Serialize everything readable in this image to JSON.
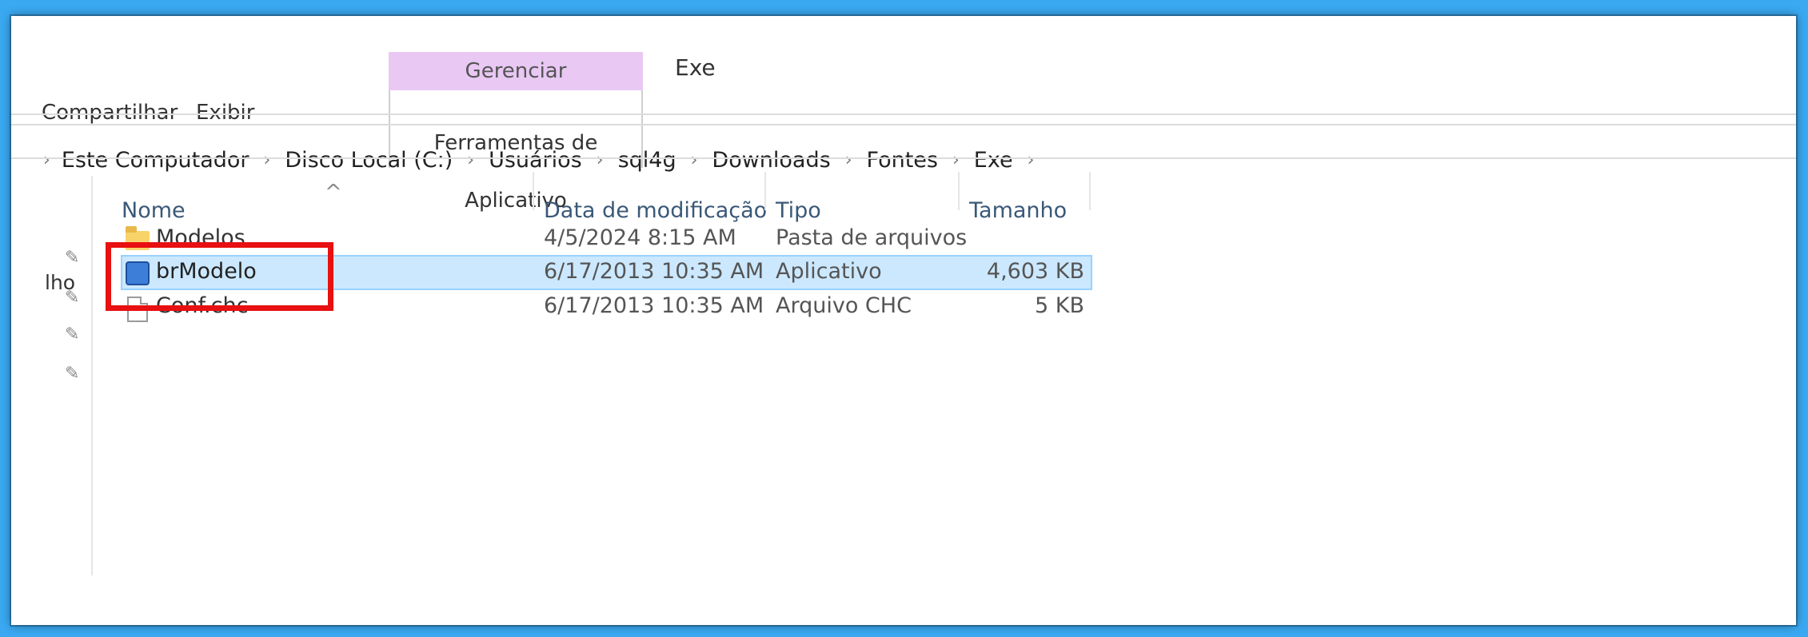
{
  "ribbon": {
    "context_group": "Gerenciar",
    "context_title": "Exe",
    "tabs": [
      "Compartilhar",
      "Exibir",
      "Ferramentas de Aplicativo"
    ]
  },
  "address_bar": {
    "path": [
      "Este Computador",
      "Disco Local (C:)",
      "Usuários",
      "sql4g",
      "Downloads",
      "Fontes",
      "Exe"
    ]
  },
  "nav_pane": {
    "partial_label": "lho"
  },
  "columns": [
    "Nome",
    "Data de modificação",
    "Tipo",
    "Tamanho"
  ],
  "files": [
    {
      "name": "Modelos",
      "date": "4/5/2024 8:15 AM",
      "type": "Pasta de arquivos",
      "size": "",
      "icon": "folder-icon",
      "selected": false
    },
    {
      "name": "brModelo",
      "date": "6/17/2013 10:35 AM",
      "type": "Aplicativo",
      "size": "4,603 KB",
      "icon": "app-icon",
      "selected": true
    },
    {
      "name": "Conf.chc",
      "date": "6/17/2013 10:35 AM",
      "type": "Arquivo CHC",
      "size": "5 KB",
      "icon": "file-icon",
      "selected": false
    }
  ],
  "colors": {
    "background": "#3aa9f2",
    "context_tab": "#e9c8f4",
    "selection": "#cce8ff",
    "highlight_box": "#e81010"
  }
}
